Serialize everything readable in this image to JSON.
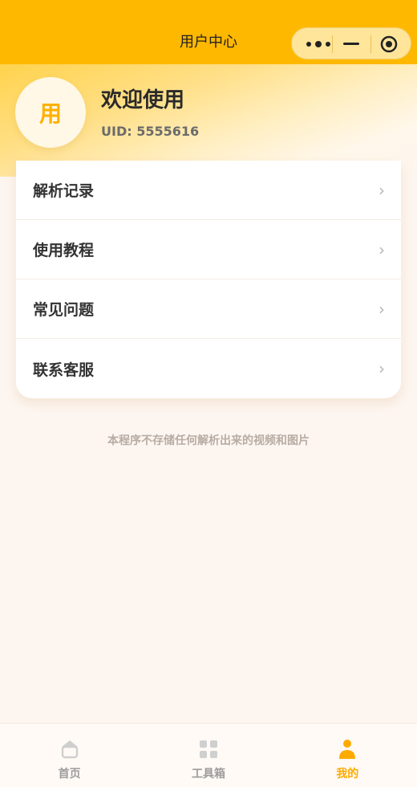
{
  "navbar": {
    "title": "用户中心",
    "capsule": {
      "more_icon": "more-dots-icon",
      "minimize_icon": "minimize-icon",
      "close_icon": "target-close-icon"
    }
  },
  "profile": {
    "avatar_char": "用",
    "welcome": "欢迎使用",
    "uid": "UID: 5555616"
  },
  "menu": {
    "items": [
      {
        "label": "解析记录",
        "chevron": "›"
      },
      {
        "label": "使用教程",
        "chevron": "›"
      },
      {
        "label": "常见问题",
        "chevron": "›"
      },
      {
        "label": "联系客服",
        "chevron": "›"
      }
    ]
  },
  "disclaimer": "本程序不存储任何解析出来的视频和图片",
  "tabbar": {
    "tabs": [
      {
        "label": "首页",
        "icon": "home-icon",
        "active": false
      },
      {
        "label": "工具箱",
        "icon": "grid-icon",
        "active": false
      },
      {
        "label": "我的",
        "icon": "user-icon",
        "active": true
      }
    ]
  },
  "colors": {
    "brand": "#ffb800",
    "active_tab": "#ffaa00",
    "inactive_tab": "#9c9c9c"
  }
}
